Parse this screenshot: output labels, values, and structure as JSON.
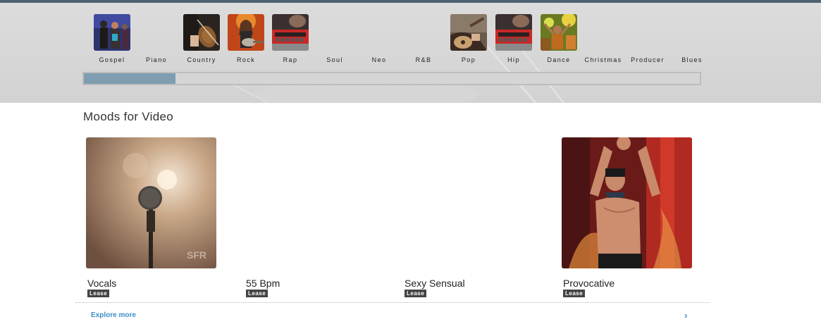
{
  "genres": [
    {
      "label": "Gospel",
      "has_image": true,
      "icon": "gospel-singers-image"
    },
    {
      "label": "Piano",
      "has_image": false,
      "icon": ""
    },
    {
      "label": "Country",
      "has_image": true,
      "icon": "violin-image"
    },
    {
      "label": "Rock",
      "has_image": true,
      "icon": "rock-guitarist-image"
    },
    {
      "label": "Rap",
      "has_image": true,
      "icon": "beat-machine-image"
    },
    {
      "label": "Soul",
      "has_image": false,
      "icon": ""
    },
    {
      "label": "Neo",
      "has_image": false,
      "icon": ""
    },
    {
      "label": "R&B",
      "has_image": false,
      "icon": ""
    },
    {
      "label": "Pop",
      "has_image": true,
      "icon": "acoustic-guitar-image"
    },
    {
      "label": "Hip",
      "has_image": true,
      "icon": "beat-machine-image"
    },
    {
      "label": "Dance",
      "has_image": true,
      "icon": "dance-party-image"
    },
    {
      "label": "Christmas",
      "has_image": false,
      "icon": ""
    },
    {
      "label": "Producer",
      "has_image": false,
      "icon": ""
    },
    {
      "label": "Blues",
      "has_image": false,
      "icon": ""
    }
  ],
  "genre_scroll": {
    "position_fraction": 0.15
  },
  "section": {
    "title": "Moods for Video"
  },
  "cards": [
    {
      "title": "Vocals",
      "badge": "Lease",
      "has_image": true,
      "icon": "microphone-image"
    },
    {
      "title": "55 Bpm",
      "badge": "Lease",
      "has_image": false,
      "icon": ""
    },
    {
      "title": "Sexy Sensual",
      "badge": "Lease",
      "has_image": false,
      "icon": ""
    },
    {
      "title": "Provocative",
      "badge": "Lease",
      "has_image": true,
      "icon": "performer-image"
    }
  ],
  "explore": {
    "label": "Explore more",
    "icon": "chevron-right-icon"
  },
  "colors": {
    "accent": "#3a8fc7",
    "top_border": "#4f6170",
    "scroll_thumb": "#7e9db0",
    "badge_bg": "#444444"
  }
}
